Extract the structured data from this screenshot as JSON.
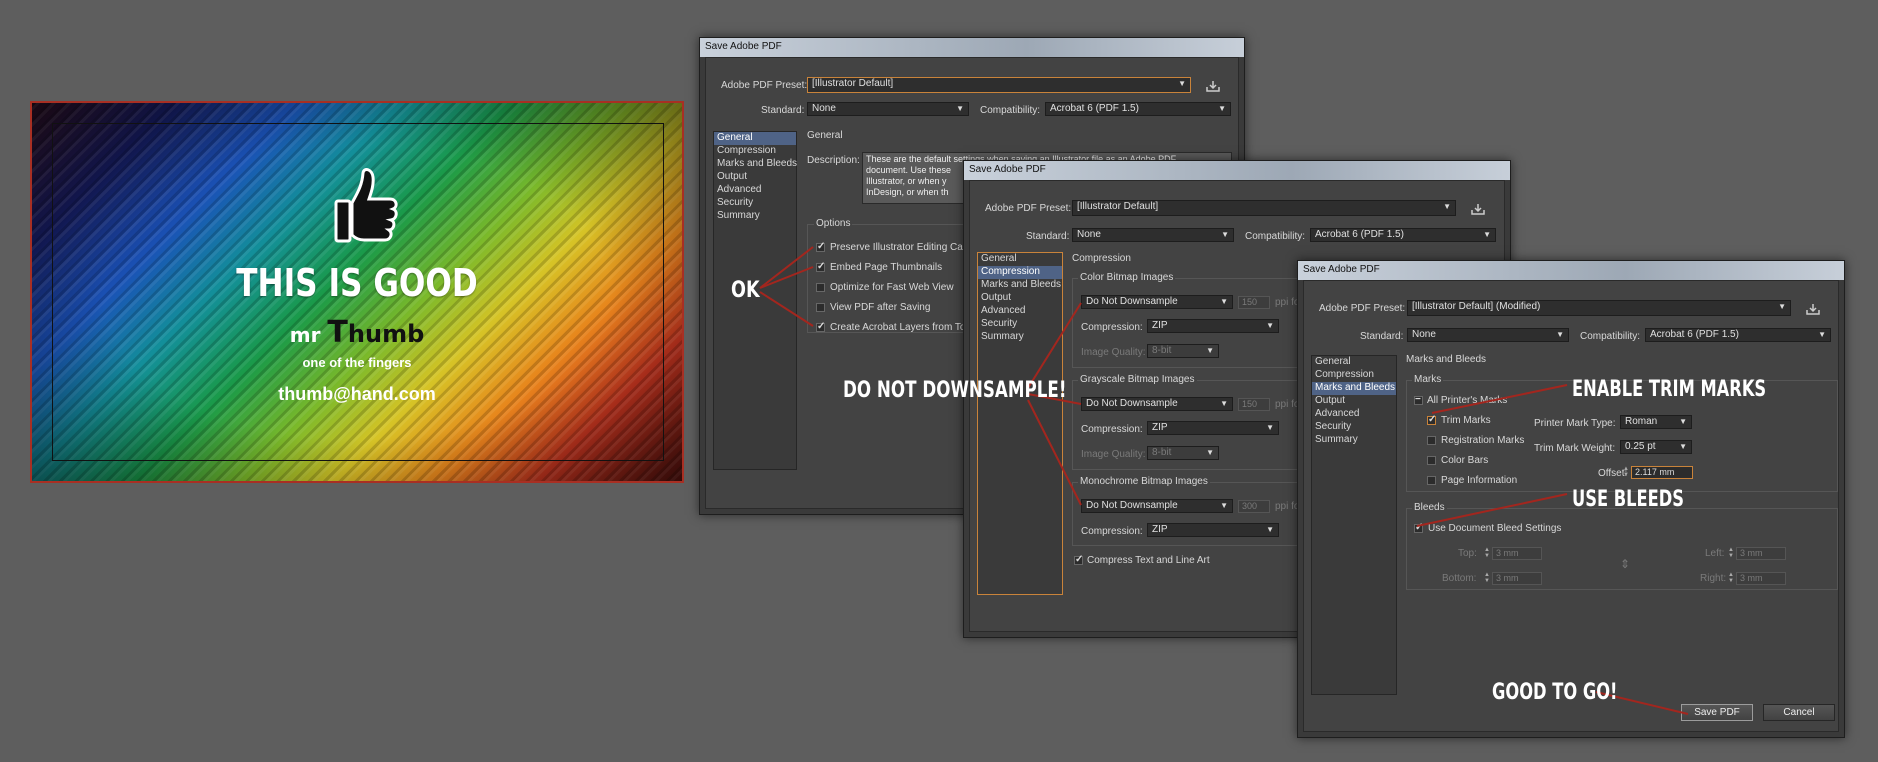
{
  "card": {
    "headline": "THIS IS GOOD",
    "name_prefix": "mr",
    "name_big": "T",
    "name_rest": "humb",
    "tagline": "one of the fingers",
    "email": "thumb@hand.com",
    "icon": "thumbs-up-icon"
  },
  "annotations": {
    "ok": "OK",
    "downsample": "DO NOT DOWNSAMPLE!",
    "trim": "ENABLE TRIM MARKS",
    "bleeds": "USE BLEEDS",
    "go": "GOOD TO GO!"
  },
  "dialog1": {
    "title": "Save Adobe PDF",
    "preset_label": "Adobe PDF Preset:",
    "preset": "[Illustrator Default]",
    "standard_label": "Standard:",
    "standard": "None",
    "compat_label": "Compatibility:",
    "compat": "Acrobat 6 (PDF 1.5)",
    "nav": [
      "General",
      "Compression",
      "Marks and Bleeds",
      "Output",
      "Advanced",
      "Security",
      "Summary"
    ],
    "section": "General",
    "desc_label": "Description:",
    "desc_lines": [
      "These are the default settings when saving an Illustrator file as an Adobe PDF",
      "document. Use these",
      "Illustrator, or when y",
      "InDesign, or when th"
    ],
    "options_label": "Options",
    "options": [
      {
        "label": "Preserve Illustrator Editing Ca",
        "checked": true
      },
      {
        "label": "Embed Page Thumbnails",
        "checked": true
      },
      {
        "label": "Optimize for Fast Web View",
        "checked": false
      },
      {
        "label": "View PDF after Saving",
        "checked": false
      },
      {
        "label": "Create Acrobat Layers from To",
        "checked": true
      }
    ]
  },
  "dialog2": {
    "title": "Save Adobe PDF",
    "preset_label": "Adobe PDF Preset:",
    "preset": "[Illustrator Default]",
    "standard_label": "Standard:",
    "standard": "None",
    "compat_label": "Compatibility:",
    "compat": "Acrobat 6 (PDF 1.5)",
    "nav": [
      "General",
      "Compression",
      "Marks and Bleeds",
      "Output",
      "Advanced",
      "Security",
      "Summary"
    ],
    "section": "Compression",
    "color_label": "Color Bitmap Images",
    "gray_label": "Grayscale Bitmap Images",
    "mono_label": "Monochrome Bitmap Images",
    "downsample": "Do Not Downsample",
    "ppi_color": "150",
    "ppi_gray": "150",
    "ppi_mono": "300",
    "ppi_label": "ppi fo",
    "compression_label": "Compression:",
    "compression": "ZIP",
    "quality_label": "Image Quality:",
    "quality": "8-bit",
    "compress_text": "Compress Text and Line Art"
  },
  "dialog3": {
    "title": "Save Adobe PDF",
    "preset_label": "Adobe PDF Preset:",
    "preset": "[Illustrator Default] (Modified)",
    "standard_label": "Standard:",
    "standard": "None",
    "compat_label": "Compatibility:",
    "compat": "Acrobat 6 (PDF 1.5)",
    "nav": [
      "General",
      "Compression",
      "Marks and Bleeds",
      "Output",
      "Advanced",
      "Security",
      "Summary"
    ],
    "section": "Marks and Bleeds",
    "marks_label": "Marks",
    "all_marks": "All Printer's Marks",
    "trim": "Trim Marks",
    "registration": "Registration Marks",
    "color_bars": "Color Bars",
    "page_info": "Page Information",
    "mark_type_label": "Printer Mark Type:",
    "mark_type": "Roman",
    "weight_label": "Trim Mark Weight:",
    "weight": "0.25 pt",
    "offset_label": "Offset:",
    "offset": "2.117 mm",
    "bleeds_label": "Bleeds",
    "use_bleed": "Use Document Bleed Settings",
    "top_label": "Top:",
    "bottom_label": "Bottom:",
    "left_label": "Left:",
    "right_label": "Right:",
    "top": "3 mm",
    "bottom": "3 mm",
    "left": "3 mm",
    "right": "3 mm",
    "save_btn": "Save PDF",
    "cancel_btn": "Cancel"
  }
}
